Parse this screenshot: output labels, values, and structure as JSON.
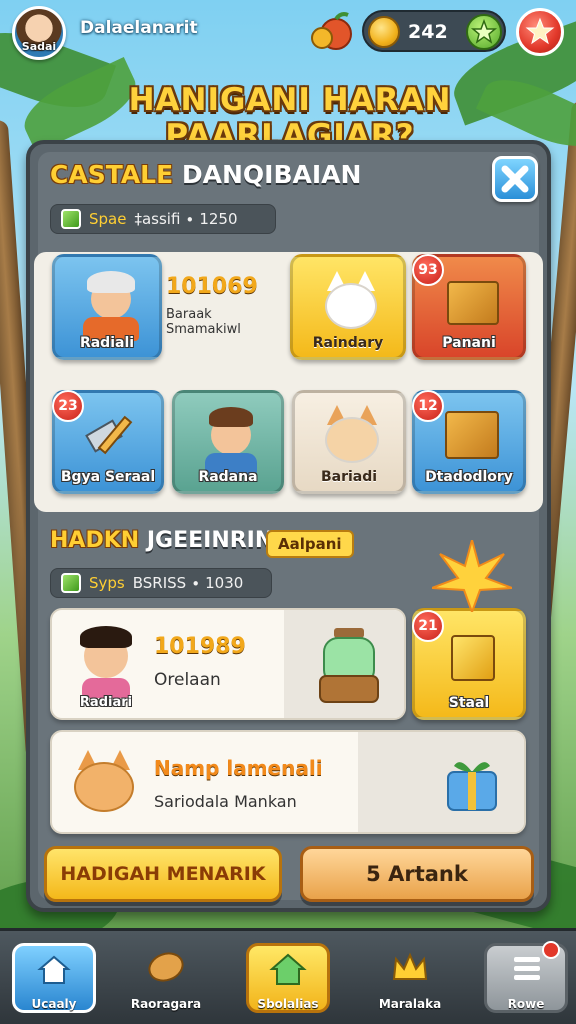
{
  "header": {
    "avatar_tag": "Sadai",
    "player_name": "Dalaelanarit",
    "coins": "242"
  },
  "banner_title": "HANIGANI HARAN PAARLAGIAR?",
  "panel": {
    "title_highlight": "CASTALE",
    "title_rest": "DANQIBAIAN",
    "stat1": {
      "label": "Spae",
      "value": "‡assifi ∙ 1250"
    },
    "grid_cards": [
      {
        "label": "Radiali",
        "color": "#3d93d6"
      },
      {
        "label": "Raindary",
        "color": "#f4b91a"
      },
      {
        "label": "Panani",
        "badge": "93",
        "color": "#d9452a"
      },
      {
        "label": "Bgya Seraal",
        "badge": "23",
        "color": "#3d93d6"
      },
      {
        "label": "Radana",
        "color": "#5aa391"
      },
      {
        "label": "Bariadi",
        "color": "#e7d9c4"
      },
      {
        "label": "Dtadodlory",
        "badge": "12",
        "color": "#3d93d6"
      }
    ],
    "grid_info": {
      "value": "101069",
      "line1": "Baraak",
      "line2": "Smamakiwl"
    },
    "section2_highlight": "HADKN",
    "section2_rest": "JGEEINRIN",
    "section2_tag": "Aalpani",
    "stat2": {
      "label": "Syps",
      "value": "BSRISS ∙ 1030"
    },
    "row1": {
      "value": "101989",
      "sub": "Orelaan",
      "avatar_label": "Radiari",
      "badge": "21",
      "chest_label": "Staal"
    },
    "row2": {
      "title": "Namp lamenali",
      "sub": "Sariodala Mankan"
    },
    "button_left": "HADIGAH MENARIK",
    "button_right": "5 Artank"
  },
  "nav": {
    "items": [
      {
        "label": "Ucaaly"
      },
      {
        "label": "Raoragara"
      },
      {
        "label": "Sbolalias"
      },
      {
        "label": "Maralaka"
      },
      {
        "label": "Rowe"
      }
    ]
  },
  "colors": {
    "accent_yellow": "#ffcf33",
    "panel_gray": "#5c666d",
    "danger_red": "#e2382a",
    "info_blue": "#2a8fd8"
  }
}
